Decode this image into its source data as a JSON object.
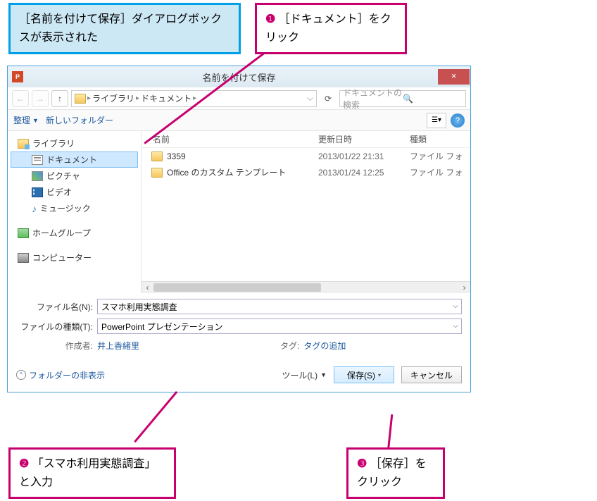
{
  "callouts": {
    "info": "［名前を付けて保存］ダイアログボックスが表示された",
    "step1_num": "❶",
    "step1": "［ドキュメント］をクリック",
    "step2_num": "❷",
    "step2": "「スマホ利用実態調査」と入力",
    "step3_num": "❸",
    "step3": "［保存］をクリック"
  },
  "dialog": {
    "title": "名前を付けて保存",
    "close": "×",
    "breadcrumb": {
      "seg1": "ライブラリ",
      "seg2": "ドキュメント"
    },
    "search_placeholder": "ドキュメントの検索",
    "toolbar": {
      "organize": "整理",
      "new_folder": "新しいフォルダー"
    },
    "tree": {
      "libraries": "ライブラリ",
      "documents": "ドキュメント",
      "pictures": "ピクチャ",
      "videos": "ビデオ",
      "music": "ミュージック",
      "homegroup": "ホームグループ",
      "computer": "コンピューター"
    },
    "cols": {
      "name": "名前",
      "date": "更新日時",
      "type": "種類"
    },
    "rows": [
      {
        "name": "3359",
        "date": "2013/01/22 21:31",
        "type": "ファイル フォ"
      },
      {
        "name": "Office のカスタム テンプレート",
        "date": "2013/01/24 12:25",
        "type": "ファイル フォ"
      }
    ],
    "form": {
      "filename_label": "ファイル名(N):",
      "filename_value": "スマホ利用実態調査",
      "filetype_label": "ファイルの種類(T):",
      "filetype_value": "PowerPoint プレゼンテーション",
      "author_label": "作成者:",
      "author_value": "井上香緒里",
      "tag_label": "タグ:",
      "tag_value": "タグの追加"
    },
    "footer": {
      "hide_folders": "フォルダーの非表示",
      "tools": "ツール(L)",
      "save": "保存(S)",
      "cancel": "キャンセル"
    }
  }
}
